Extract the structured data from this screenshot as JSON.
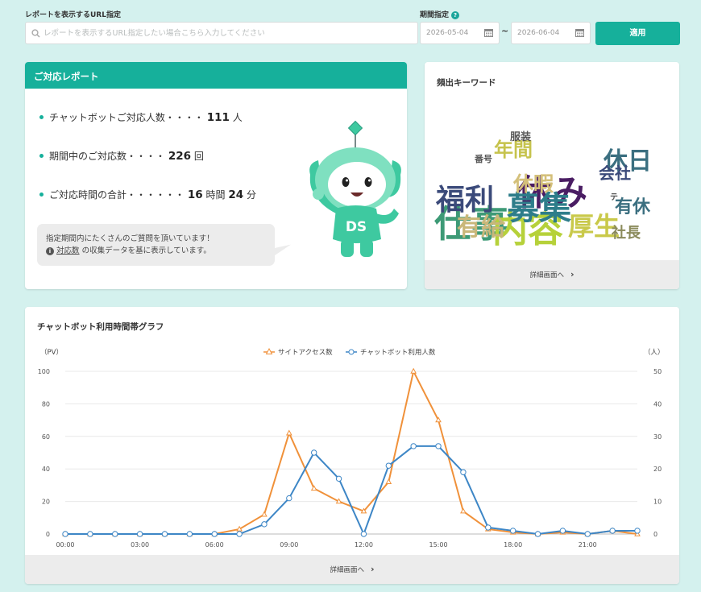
{
  "filters": {
    "url_label": "レポートを表示するURL指定",
    "url_placeholder": "レポートを表示するURL指定したい場合こちら入力してください",
    "url_value": "",
    "period_label": "期間指定",
    "help_icon": "question-circle-icon",
    "start_date": "2026-05-04",
    "end_date": "2026-06-04",
    "separator": "~",
    "apply_label": "適用"
  },
  "report": {
    "title": "ご対応レポート",
    "stats": [
      {
        "label": "チャットボットご対応人数・・・・",
        "value": "111",
        "unit": "人"
      },
      {
        "label": "期間中のご対応数・・・・",
        "value": "226",
        "unit": "回"
      },
      {
        "label": "ご対応時間の合計・・・・・・",
        "value": "16",
        "unit": "時間",
        "value2": "24",
        "unit2": "分"
      }
    ],
    "message_line1": "指定期間内にたくさんのご質問を頂いています！",
    "message_link": "対応数",
    "message_rest": "の収集データを基に表示しています。",
    "mascot_text": "DS"
  },
  "keywords": {
    "title": "頻出キーワード",
    "words": [
      {
        "text": "仕事",
        "color": "#3d9a76"
      },
      {
        "text": "内容",
        "color": "#b6d13a"
      },
      {
        "text": "休み",
        "color": "#4a1d63"
      },
      {
        "text": "募集",
        "color": "#2d7d8a"
      },
      {
        "text": "福利",
        "color": "#3b4a7a"
      },
      {
        "text": "休日",
        "color": "#3b6f80"
      },
      {
        "text": "年間",
        "color": "#c6c34d"
      },
      {
        "text": "休暇",
        "color": "#d4c07a"
      },
      {
        "text": "厚生",
        "color": "#c9c94a"
      },
      {
        "text": "有休",
        "color": "#3b6f80"
      },
      {
        "text": "社長",
        "color": "#8a8a5a"
      },
      {
        "text": "服装",
        "color": "#555555"
      },
      {
        "text": "会社",
        "color": "#3b4a7a"
      },
      {
        "text": "番号",
        "color": "#555555"
      },
      {
        "text": "有給",
        "color": "#c9b77a"
      },
      {
        "text": "テ",
        "color": "#555555"
      }
    ],
    "detail_label": "詳細画面へ"
  },
  "graph": {
    "title": "チャットボット利用時間帯グラフ",
    "detail_label": "詳細画面へ",
    "chart_data": {
      "type": "line",
      "x": [
        "00:00",
        "01:00",
        "02:00",
        "03:00",
        "04:00",
        "05:00",
        "06:00",
        "07:00",
        "08:00",
        "09:00",
        "10:00",
        "11:00",
        "12:00",
        "13:00",
        "14:00",
        "15:00",
        "16:00",
        "17:00",
        "18:00",
        "19:00",
        "20:00",
        "21:00",
        "22:00",
        "23:00"
      ],
      "xticks": [
        "00:00",
        "03:00",
        "06:00",
        "09:00",
        "12:00",
        "15:00",
        "18:00",
        "21:00"
      ],
      "ylabel_left": "（PV）",
      "ylabel_right": "（人）",
      "ylim_left": [
        0,
        100
      ],
      "ylim_right": [
        0,
        50
      ],
      "yticks_left": [
        0,
        20,
        40,
        60,
        80,
        100
      ],
      "yticks_right": [
        0,
        10,
        20,
        30,
        40,
        50
      ],
      "grid": true,
      "legend_position": "top",
      "series": [
        {
          "name": "サイトアクセス数",
          "axis": "left",
          "color": "#f0913a",
          "marker": "triangle",
          "values": [
            0,
            0,
            0,
            0,
            0,
            0,
            0,
            3,
            12,
            62,
            28,
            20,
            14,
            32,
            100,
            70,
            14,
            3,
            1,
            0,
            1,
            0,
            2,
            0
          ]
        },
        {
          "name": "チャットボット利用人数",
          "axis": "right",
          "color": "#3d86c6",
          "marker": "circle",
          "values": [
            0,
            0,
            0,
            0,
            0,
            0,
            0,
            0,
            3,
            11,
            25,
            17,
            0,
            21,
            27,
            27,
            19,
            2,
            1,
            0,
            1,
            0,
            1,
            1,
            0
          ]
        }
      ]
    }
  }
}
